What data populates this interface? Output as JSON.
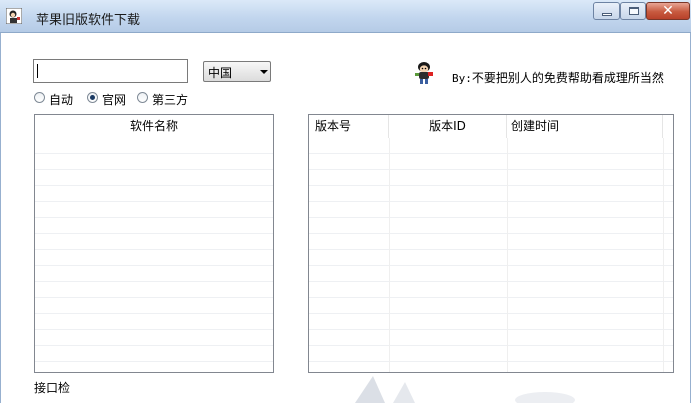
{
  "window": {
    "title": "苹果旧版软件下载",
    "minimize_icon": "minimize-icon",
    "maximize_icon": "maximize-icon",
    "close_icon": "close-icon",
    "close_glyph": "✕"
  },
  "toolbar": {
    "search_value": "",
    "search_placeholder": "",
    "region_selected": "中国"
  },
  "source_options": {
    "items": [
      {
        "label": "自动",
        "selected": false
      },
      {
        "label": "官网",
        "selected": true
      },
      {
        "label": "第三方",
        "selected": false
      }
    ]
  },
  "credit": {
    "prefix": "By:",
    "text": "不要把别人的免费帮助看成理所当然",
    "icon": "cartoon-character-icon"
  },
  "software_list": {
    "header": "软件名称",
    "rows": []
  },
  "version_list": {
    "columns": [
      "版本号",
      "版本ID",
      "创建时间"
    ],
    "rows": []
  },
  "status": {
    "text": "接口检"
  },
  "colors": {
    "titlebar": "#c2d6ee",
    "close_button": "#c75a3f",
    "list_border": "#828790",
    "radio_dot": "#1b3a63"
  }
}
